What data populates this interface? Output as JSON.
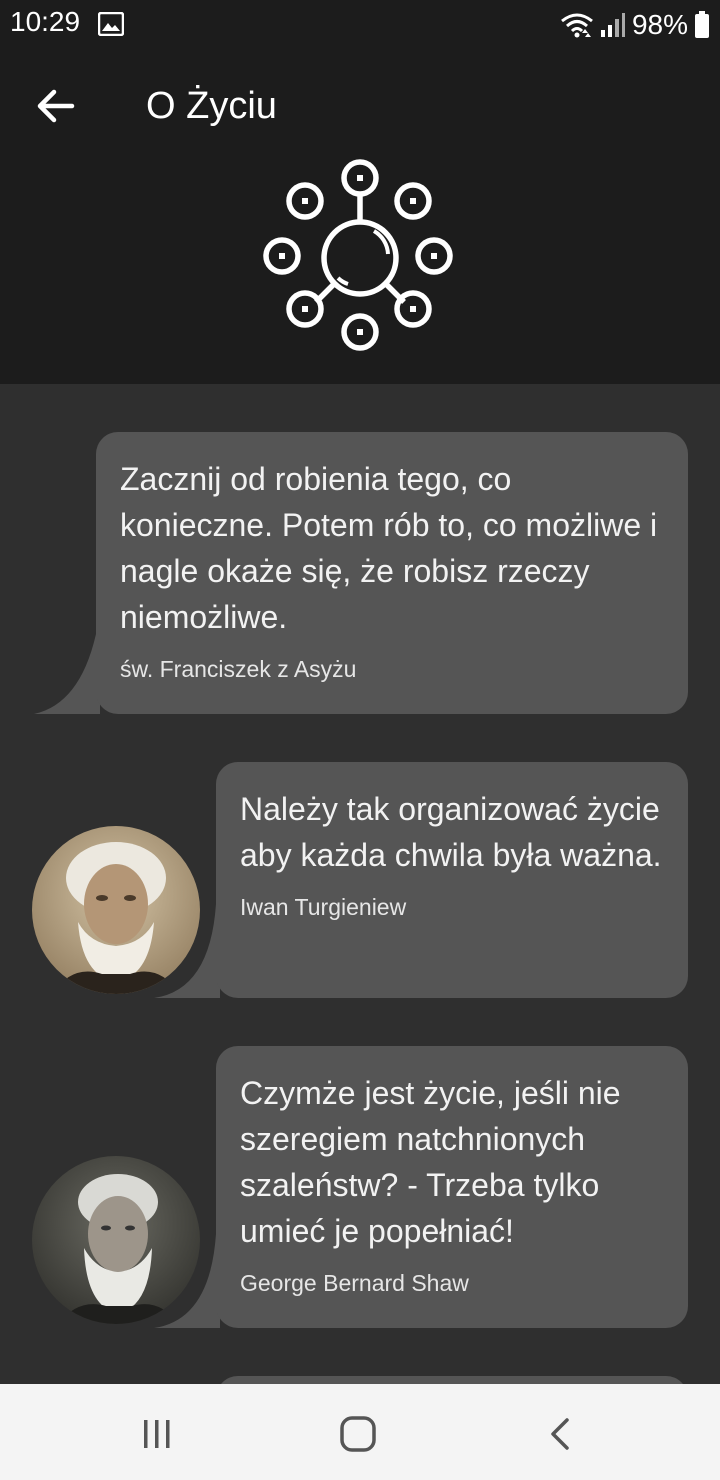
{
  "status_bar": {
    "time": "10:29",
    "battery": "98%",
    "icons": [
      "image-notification-icon",
      "wifi-icon",
      "signal-icon",
      "battery-icon"
    ]
  },
  "header": {
    "title": "O Życiu",
    "back_icon": "arrow-left-icon",
    "logo_icon": "network-circle-icon"
  },
  "quotes": [
    {
      "text": "Zacznij od robienia tego, co konieczne. Potem rób to, co możliwe i nagle okaże się, że robisz rzeczy niemożliwe.",
      "author": "św. Franciszek z Asyżu",
      "has_avatar": false
    },
    {
      "text": "Należy tak organizować życie aby każda chwila była ważna.",
      "author": "Iwan Turgieniew",
      "has_avatar": true
    },
    {
      "text": "Czymże jest życie, jeśli nie szeregiem natchnionych szaleństw? - Trzeba tylko umieć je popełniać!",
      "author": "George Bernard Shaw",
      "has_avatar": true
    }
  ],
  "nav_bar": {
    "buttons": [
      "recent-apps-icon",
      "home-icon",
      "back-nav-icon"
    ]
  },
  "colors": {
    "header_bg": "#1c1c1c",
    "content_bg": "#2f2f2f",
    "card_bg": "#555555",
    "nav_bg": "#f4f4f4"
  }
}
